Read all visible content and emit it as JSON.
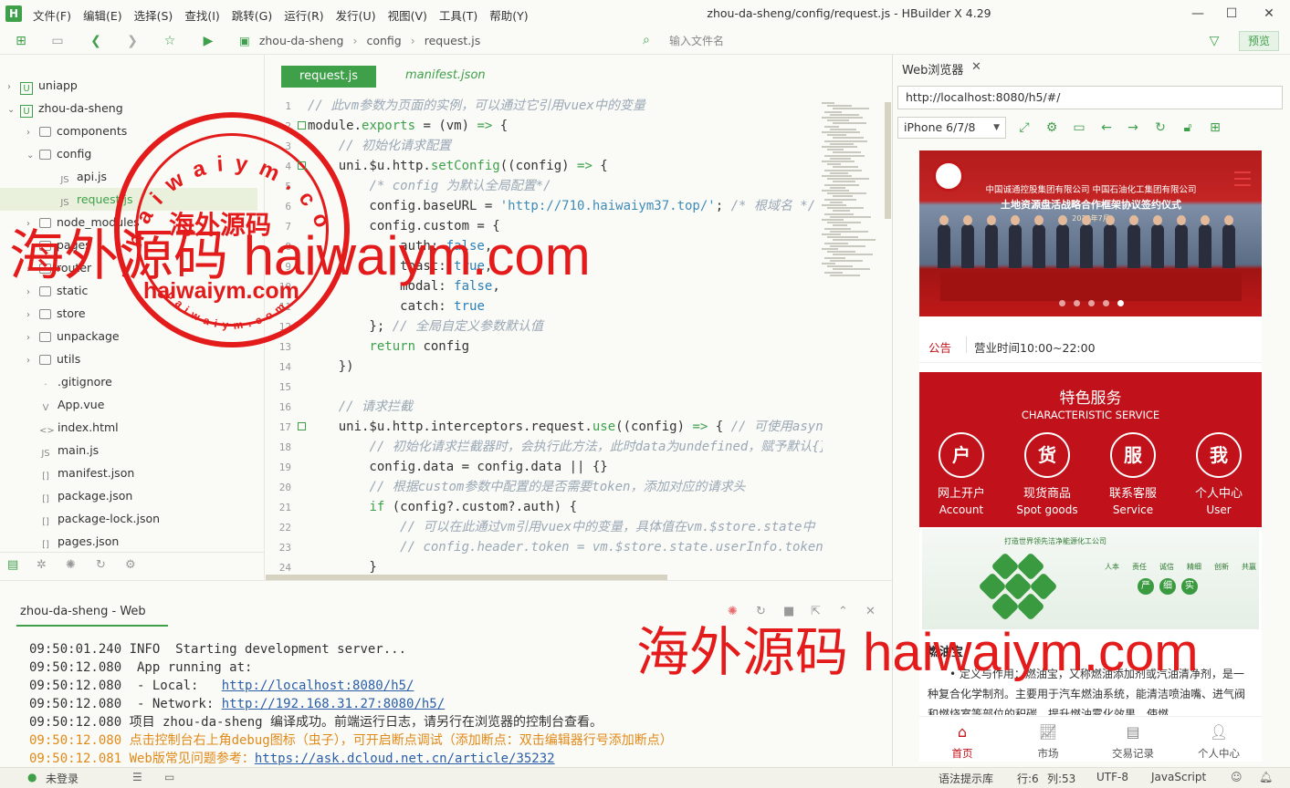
{
  "window": {
    "title": "zhou-da-sheng/config/request.js - HBuilder X 4.29",
    "menu": [
      "文件(F)",
      "编辑(E)",
      "选择(S)",
      "查找(I)",
      "跳转(G)",
      "运行(R)",
      "发行(U)",
      "视图(V)",
      "工具(T)",
      "帮助(Y)"
    ]
  },
  "toolbar": {
    "breadcrumb": [
      "zhou-da-sheng",
      "config",
      "request.js"
    ],
    "search_placeholder": "输入文件名",
    "preview_label": "预览"
  },
  "tree": [
    {
      "label": "uniapp",
      "level": 0,
      "type": "project",
      "expanded": false
    },
    {
      "label": "zhou-da-sheng",
      "level": 0,
      "type": "project",
      "expanded": true
    },
    {
      "label": "components",
      "level": 1,
      "type": "folder",
      "expanded": false
    },
    {
      "label": "config",
      "level": 1,
      "type": "folder",
      "expanded": true
    },
    {
      "label": "api.js",
      "level": 2,
      "type": "js"
    },
    {
      "label": "request.js",
      "level": 2,
      "type": "js",
      "selected": true
    },
    {
      "label": "node_modules",
      "level": 1,
      "type": "folder",
      "expanded": false
    },
    {
      "label": "pages",
      "level": 1,
      "type": "folder",
      "expanded": false
    },
    {
      "label": "router",
      "level": 1,
      "type": "folder",
      "expanded": false
    },
    {
      "label": "static",
      "level": 1,
      "type": "folder",
      "expanded": false
    },
    {
      "label": "store",
      "level": 1,
      "type": "folder",
      "expanded": false
    },
    {
      "label": "unpackage",
      "level": 1,
      "type": "folder",
      "expanded": false
    },
    {
      "label": "utils",
      "level": 1,
      "type": "folder",
      "expanded": false
    },
    {
      "label": ".gitignore",
      "level": 1,
      "type": "file"
    },
    {
      "label": "App.vue",
      "level": 1,
      "type": "vue"
    },
    {
      "label": "index.html",
      "level": 1,
      "type": "html"
    },
    {
      "label": "main.js",
      "level": 1,
      "type": "js"
    },
    {
      "label": "manifest.json",
      "level": 1,
      "type": "json"
    },
    {
      "label": "package.json",
      "level": 1,
      "type": "json"
    },
    {
      "label": "package-lock.json",
      "level": 1,
      "type": "json"
    },
    {
      "label": "pages.json",
      "level": 1,
      "type": "json"
    }
  ],
  "editor": {
    "tabs": [
      "request.js",
      "manifest.json"
    ],
    "active_tab": "request.js",
    "lines": [
      {
        "n": "1",
        "segs": [
          [
            "cm",
            "// 此vm参数为页面的实例，可以通过它引用vuex中的变量"
          ]
        ]
      },
      {
        "n": "2",
        "segs": [
          [
            "pn",
            "module"
          ],
          [
            "pn",
            "."
          ],
          [
            "kw",
            "exports"
          ],
          [
            "pn",
            " = (vm) "
          ],
          [
            "kw",
            "=>"
          ],
          [
            "pn",
            " {"
          ]
        ]
      },
      {
        "n": "3",
        "segs": [
          [
            "pn",
            "    "
          ],
          [
            "cm",
            "// 初始化请求配置"
          ]
        ]
      },
      {
        "n": "4",
        "segs": [
          [
            "pn",
            "    uni.$u.http."
          ],
          [
            "fn",
            "setConfig"
          ],
          [
            "pn",
            "((config) "
          ],
          [
            "kw",
            "=>"
          ],
          [
            "pn",
            " {"
          ]
        ]
      },
      {
        "n": "5",
        "segs": [
          [
            "pn",
            "        "
          ],
          [
            "cm",
            "/* config 为默认全局配置*/"
          ]
        ]
      },
      {
        "n": "6",
        "segs": [
          [
            "pn",
            "        config.baseURL = "
          ],
          [
            "st",
            "'http://710.haiwaiym37.top/'"
          ],
          [
            "pn",
            "; "
          ],
          [
            "cm",
            "/* 根域名 */"
          ]
        ]
      },
      {
        "n": "7",
        "segs": [
          [
            "pn",
            "        config.custom = {"
          ]
        ]
      },
      {
        "n": "8",
        "segs": [
          [
            "pn",
            "            auth: "
          ],
          [
            "nm",
            "false"
          ],
          [
            "pn",
            ","
          ]
        ]
      },
      {
        "n": "9",
        "segs": [
          [
            "pn",
            "            toast: "
          ],
          [
            "nm",
            "true"
          ],
          [
            "pn",
            ","
          ]
        ]
      },
      {
        "n": "10",
        "segs": [
          [
            "pn",
            "            modal: "
          ],
          [
            "nm",
            "false"
          ],
          [
            "pn",
            ","
          ]
        ]
      },
      {
        "n": "11",
        "segs": [
          [
            "pn",
            "            catch: "
          ],
          [
            "nm",
            "true"
          ]
        ]
      },
      {
        "n": "12",
        "segs": [
          [
            "pn",
            "        }; "
          ],
          [
            "cm",
            "// 全局自定义参数默认值"
          ]
        ]
      },
      {
        "n": "13",
        "segs": [
          [
            "pn",
            "        "
          ],
          [
            "kw",
            "return"
          ],
          [
            "pn",
            " config"
          ]
        ]
      },
      {
        "n": "14",
        "segs": [
          [
            "pn",
            "    })"
          ]
        ]
      },
      {
        "n": "15",
        "segs": [
          [
            "pn",
            ""
          ]
        ]
      },
      {
        "n": "16",
        "segs": [
          [
            "pn",
            "    "
          ],
          [
            "cm",
            "// 请求拦截"
          ]
        ]
      },
      {
        "n": "17",
        "segs": [
          [
            "pn",
            "    uni.$u.http.interceptors.request."
          ],
          [
            "fn",
            "use"
          ],
          [
            "pn",
            "((config) "
          ],
          [
            "kw",
            "=>"
          ],
          [
            "pn",
            " { "
          ],
          [
            "cm",
            "// 可使用async await"
          ]
        ]
      },
      {
        "n": "18",
        "segs": [
          [
            "pn",
            "        "
          ],
          [
            "cm",
            "// 初始化请求拦截器时，会执行此方法，此时data为undefined，赋予默认{}"
          ]
        ]
      },
      {
        "n": "19",
        "segs": [
          [
            "pn",
            "        config.data = config.data || {}"
          ]
        ]
      },
      {
        "n": "20",
        "segs": [
          [
            "pn",
            "        "
          ],
          [
            "cm",
            "// 根据custom参数中配置的是否需要token，添加对应的请求头"
          ]
        ]
      },
      {
        "n": "21",
        "segs": [
          [
            "pn",
            "        "
          ],
          [
            "kw",
            "if"
          ],
          [
            "pn",
            " (config?.custom?.auth) {"
          ]
        ]
      },
      {
        "n": "22",
        "segs": [
          [
            "pn",
            "            "
          ],
          [
            "cm",
            "// 可以在此通过vm引用vuex中的变量，具体值在vm.$store.state中"
          ]
        ]
      },
      {
        "n": "23",
        "segs": [
          [
            "pn",
            "            "
          ],
          [
            "cm",
            "// config.header.token = vm.$store.state.userInfo.token"
          ]
        ]
      },
      {
        "n": "24",
        "segs": [
          [
            "pn",
            "        }"
          ]
        ]
      }
    ]
  },
  "browser": {
    "tab_label": "Web浏览器",
    "url": "http://localhost:8080/h5/#/",
    "device": "iPhone 6/7/8",
    "banner": {
      "line1": "中国诚通控股集团有限公司  中国石油化工集团有限公司",
      "line2": "土地资源盘活战略合作框架协议签约仪式",
      "line3": "2022年7月"
    },
    "notice_tag": "公告",
    "notice_text": "营业时间10:00~22:00",
    "services_title": "特色服务",
    "services_subtitle": "CHARACTERISTIC SERVICE",
    "services": [
      {
        "glyph": "户",
        "label": "网上开户",
        "en": "Account"
      },
      {
        "glyph": "货",
        "label": "现货商品",
        "en": "Spot goods"
      },
      {
        "glyph": "服",
        "label": "联系客服",
        "en": "Service"
      },
      {
        "glyph": "我",
        "label": "个人中心",
        "en": "User"
      }
    ],
    "image2_title": "打造世界领先洁净能源化工公司",
    "image2_words": [
      "人本",
      "责任",
      "诚信",
      "精细",
      "创新",
      "共赢"
    ],
    "image2_tags": [
      "严",
      "细",
      "实"
    ],
    "article_title": "燃油宝",
    "article_text": "• 定义与作用：燃油宝，又称燃油添加剂或汽油清净剂，是一种复合化学制剂。主要用于汽车燃油系统，能清洁喷油嘴、进气阀和燃烧室等部位的积碳，提升燃油雾化效果，使燃",
    "tabbar": [
      "首页",
      "市场",
      "交易记录",
      "个人中心"
    ]
  },
  "console": {
    "tab_label": "zhou-da-sheng - Web",
    "lines": [
      {
        "t": "09:50:01.240",
        "txt": "INFO  Starting development server...",
        "cls": ""
      },
      {
        "t": "09:50:12.080",
        "txt": " App running at:",
        "cls": ""
      },
      {
        "t": "09:50:12.080",
        "txt": " - Local:   ",
        "link": "http://localhost:8080/h5/",
        "cls": ""
      },
      {
        "t": "09:50:12.080",
        "txt": " - Network: ",
        "link": "http://192.168.31.27:8080/h5/",
        "cls": ""
      },
      {
        "t": "09:50:12.080",
        "txt": "项目 zhou-da-sheng 编译成功。前端运行日志，请另行在浏览器的控制台查看。",
        "cls": ""
      },
      {
        "t": "09:50:12.080",
        "txt": "点击控制台右上角debug图标（虫子），可开启断点调试（添加断点：双击编辑器行号添加断点）",
        "cls": "orange"
      },
      {
        "t": "09:50:12.081",
        "txt": "Web版常见问题参考：",
        "link": "https://ask.dcloud.net.cn/article/35232",
        "cls": "orange"
      }
    ]
  },
  "status": {
    "login": "未登录",
    "syntax": "语法提示库",
    "row": "行:6",
    "col": "列:53",
    "encoding": "UTF-8",
    "language": "JavaScript"
  },
  "watermark": {
    "seal_text": "haiwaiym.com",
    "seal_cn": "海外源码",
    "big_left": "海外源码 haiwaiym.com",
    "big_right": "海外源码 haiwaiym.com",
    "seal_top": "haiwaiym.com",
    "seal_bottom": "haiwaiym.com"
  },
  "colors": {
    "accent": "#3fa04a",
    "brand_red": "#c1121b",
    "watermark": "#e31b1b"
  }
}
